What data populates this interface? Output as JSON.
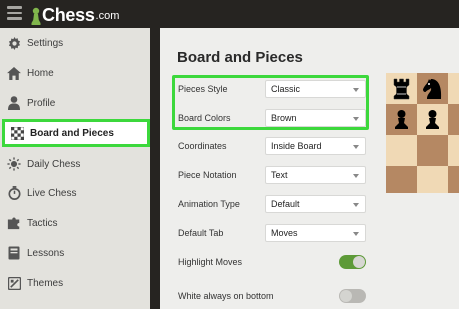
{
  "app": {
    "logo_text": "Chess",
    "logo_suffix": ".com"
  },
  "sidebar": {
    "items": [
      {
        "label": "Settings",
        "icon": "gear-icon"
      },
      {
        "label": "Home",
        "icon": "home-icon"
      },
      {
        "label": "Profile",
        "icon": "user-icon"
      },
      {
        "label": "Board and Pieces",
        "icon": "board-icon",
        "active": true
      },
      {
        "label": "Daily Chess",
        "icon": "sun-icon"
      },
      {
        "label": "Live Chess",
        "icon": "stopwatch-icon"
      },
      {
        "label": "Tactics",
        "icon": "puzzle-icon"
      },
      {
        "label": "Lessons",
        "icon": "book-icon"
      },
      {
        "label": "Themes",
        "icon": "palette-icon"
      }
    ]
  },
  "main": {
    "title": "Board and Pieces",
    "settings": [
      {
        "label": "Pieces Style",
        "value": "Classic"
      },
      {
        "label": "Board Colors",
        "value": "Brown"
      },
      {
        "label": "Coordinates",
        "value": "Inside Board"
      },
      {
        "label": "Piece Notation",
        "value": "Text"
      },
      {
        "label": "Animation Type",
        "value": "Default"
      },
      {
        "label": "Default Tab",
        "value": "Moves"
      }
    ],
    "toggles": [
      {
        "label": "Highlight Moves",
        "on": true
      },
      {
        "label": "White always on bottom",
        "on": false
      }
    ]
  },
  "colors": {
    "accent_highlight": "#3cd83c",
    "toggle_on": "#5d9a38",
    "board_light": "#f0d9b5",
    "board_dark": "#b58863"
  }
}
